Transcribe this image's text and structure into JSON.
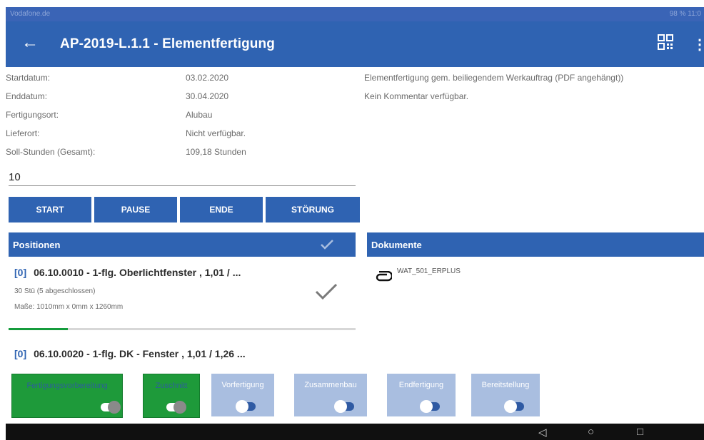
{
  "statusbar": {
    "carrier": "Vodafone.de",
    "right": "98 % 11:0"
  },
  "appbar": {
    "title": "AP-2019-L.1.1 - Elementfertigung",
    "back_icon": "arrow-left-icon",
    "qr_icon": "qr-code-icon",
    "more_icon": "more-vertical-icon"
  },
  "info": {
    "rows": [
      {
        "label": "Startdatum:",
        "value": "03.02.2020"
      },
      {
        "label": "Enddatum:",
        "value": "30.04.2020"
      },
      {
        "label": "Fertigungsort:",
        "value": "Alubau"
      },
      {
        "label": "Lieferort:",
        "value": "Nicht verfügbar."
      },
      {
        "label": "Soll-Stunden (Gesamt):",
        "value": "109,18 Stunden"
      }
    ],
    "description": "Elementfertigung gem. beiliegendem Werkauftrag (PDF angehängt))",
    "comment": "Kein Kommentar verfügbar."
  },
  "quantity": {
    "value": "10"
  },
  "buttons": {
    "start": "START",
    "pause": "PAUSE",
    "ende": "ENDE",
    "stoerung": "STÖRUNG"
  },
  "positionen": {
    "header": "Positionen",
    "items": [
      {
        "index": "[0]",
        "title": "06.10.0010 - 1-flg. Oberlichtfenster ,  1,01 / ...",
        "count": "30 Stü (5 abgeschlossen)",
        "dims": "Maße: 1010mm x 0mm x 1260mm",
        "progress": 0.17
      },
      {
        "index": "[0]",
        "title": "06.10.0020 - 1-flg. DK - Fenster ,  1,01 / 1,26 ..."
      }
    ]
  },
  "dokumente": {
    "header": "Dokumente",
    "items": [
      {
        "name": "WAT_501_ERPLUS",
        "icon": "paperclip-icon"
      }
    ]
  },
  "phases": [
    {
      "label": "Fertigungsvorbereitung",
      "active": true
    },
    {
      "label": "Zuschnitt",
      "active": true
    },
    {
      "label": "Vorfertigung",
      "active": false
    },
    {
      "label": "Zusammenbau",
      "active": false
    },
    {
      "label": "Endfertigung",
      "active": false
    },
    {
      "label": "Bereitstellung",
      "active": false
    }
  ],
  "colors": {
    "primary": "#2f63b2",
    "active_green": "#1e9a3a",
    "inactive_phase": "#a9bee0"
  },
  "navbar": {
    "back": "◁",
    "home": "○",
    "recents": "□"
  }
}
